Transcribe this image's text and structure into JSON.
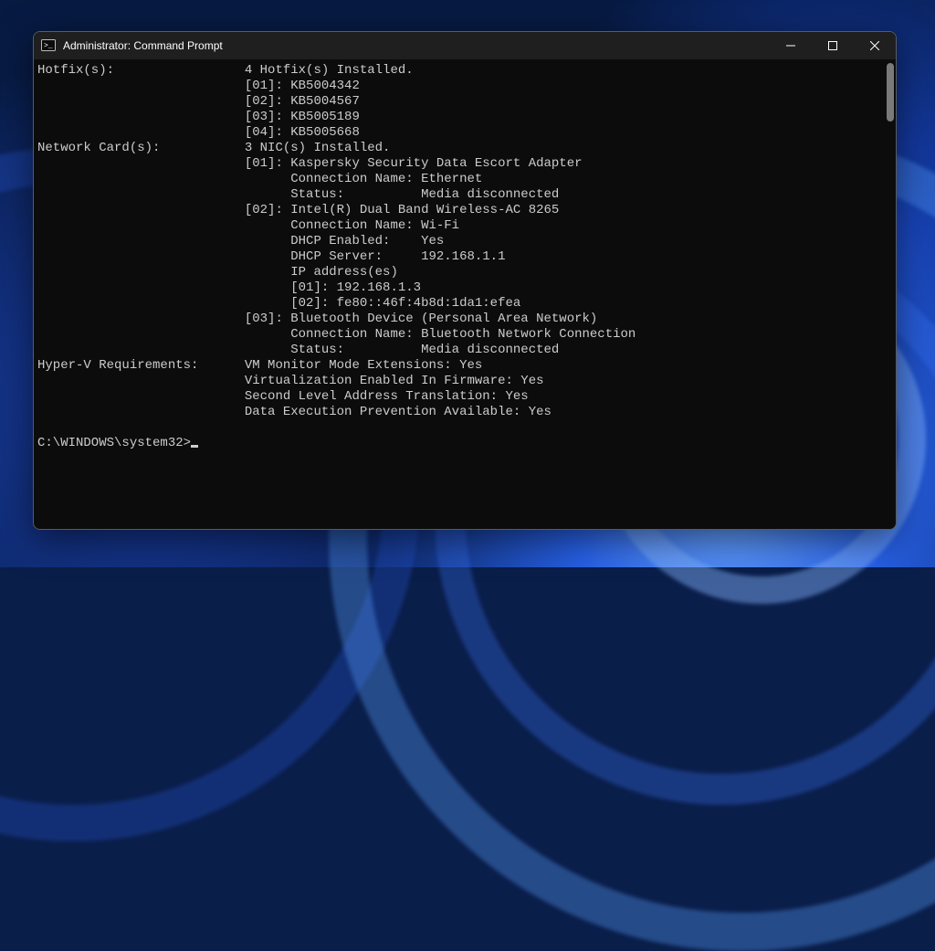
{
  "window": {
    "title": "Administrator: Command Prompt"
  },
  "terminal": {
    "lines": [
      "Hotfix(s):                 4 Hotfix(s) Installed.",
      "                           [01]: KB5004342",
      "                           [02]: KB5004567",
      "                           [03]: KB5005189",
      "                           [04]: KB5005668",
      "Network Card(s):           3 NIC(s) Installed.",
      "                           [01]: Kaspersky Security Data Escort Adapter",
      "                                 Connection Name: Ethernet",
      "                                 Status:          Media disconnected",
      "                           [02]: Intel(R) Dual Band Wireless-AC 8265",
      "                                 Connection Name: Wi-Fi",
      "                                 DHCP Enabled:    Yes",
      "                                 DHCP Server:     192.168.1.1",
      "                                 IP address(es)",
      "                                 [01]: 192.168.1.3",
      "                                 [02]: fe80::46f:4b8d:1da1:efea",
      "                           [03]: Bluetooth Device (Personal Area Network)",
      "                                 Connection Name: Bluetooth Network Connection",
      "                                 Status:          Media disconnected",
      "Hyper-V Requirements:      VM Monitor Mode Extensions: Yes",
      "                           Virtualization Enabled In Firmware: Yes",
      "                           Second Level Address Translation: Yes",
      "                           Data Execution Prevention Available: Yes",
      "",
      "C:\\WINDOWS\\system32>"
    ],
    "prompt": "C:\\WINDOWS\\system32>"
  }
}
